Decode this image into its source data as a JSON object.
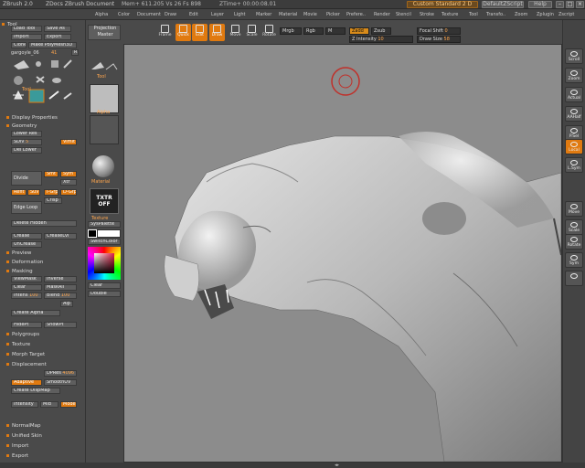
{
  "titlebar": {
    "app": "ZBrush 2.0",
    "doc": "ZDocs ZBrush Document",
    "mem": "Mem+ 611.205 Vs 26 Fs 898",
    "ztime": "ZTime+ 00:00:08.01",
    "script_label": "Custom Standard 2 D",
    "default_script": "DefaultZScript",
    "help": "Help"
  },
  "menu": [
    "Alpha",
    "Color",
    "Document",
    "Draw",
    "Edit",
    "Layer",
    "Light",
    "Marker",
    "Material",
    "Movie",
    "Picker",
    "Prefere..",
    "Render",
    "Stencil",
    "Stroke",
    "Texture",
    "Tool",
    "Transfo..",
    "Zoom",
    "Zplugin",
    "Zscript"
  ],
  "toolbar": {
    "projection_master": "Projection Master",
    "tools": [
      "Frame",
      "Quick",
      "Edit",
      "Draw",
      "Move",
      "Scale",
      "Rotate"
    ],
    "mrgb": "Mrgb",
    "rgb": "Rgb",
    "m": "M",
    "zadd": "Zadd",
    "zsub": "Zsub",
    "z_intensity": "Z Intensity",
    "z_intensity_val": "10",
    "focal_shift": "Focal Shift",
    "focal_shift_val": "0",
    "draw_size": "Draw Size",
    "draw_size_val": "58"
  },
  "left": {
    "tool_header": "Tool",
    "load_tool": "Load Tool",
    "save_as": "Save As",
    "import": "Import",
    "export": "Export",
    "clone": "Clone",
    "make_polymesh": "Make PolyMesh3D",
    "tool_name": "gargoyle_06",
    "tool_num": "41",
    "r": "R",
    "tool_label": "Tool",
    "display_properties": "Display Properties",
    "geometry": "Geometry",
    "lower_res": "Lower Res",
    "sdiv": "SDiv",
    "sdiv_val": "5",
    "vimit": "Vimit",
    "del_lower": "Del Lower",
    "divide": "Divide",
    "smt": "Smt",
    "sym": "Sym",
    "xtr": "Xtr",
    "refit": "Refit",
    "suv": "Suv",
    "igrp": "I-Grp",
    "dgrp": "D-Grp",
    "crisp": "Crisp",
    "edge_loop": "Edge Loop",
    "delete_hidden": "Delete Hidden",
    "crease": "Crease",
    "crease_lvl": "CreaseLvl",
    "uncrease": "UnCrease",
    "preview": "Preview",
    "deformation": "Deformation",
    "masking": "Masking",
    "viewmask": "ViewMask",
    "inverse": "Inverse",
    "clear": "Clear",
    "maskall": "MaskAll",
    "intens": "Intens",
    "intens_val": "100",
    "blend": "Blend",
    "blend_val": "100",
    "alp": "Alp",
    "create_alpha": "Create Alpha",
    "hidept": "HidePt",
    "showpt": "ShowPt",
    "polygroups": "Polygroups",
    "texture": "Texture",
    "morph_target": "Morph Target",
    "displacement": "Displacement",
    "dpres": "DPRes",
    "dpres_val": "4096",
    "adaptive": "Adaptive",
    "smoothuv": "SmoothUV",
    "create_dispmap": "Create DispMap",
    "intensity": "Intensity",
    "intensity_val": "Mid",
    "mode": "Mode",
    "normalmap": "NormalMap",
    "unified_skin": "Unified Skin",
    "import2": "Import",
    "export2": "Export"
  },
  "palette": {
    "tool": "Tool",
    "alpha": "Alpha",
    "material": "Material",
    "txtr_off": "TXTR OFF",
    "texture": "Texture",
    "syspalette": "SysPalette",
    "switchcolor": "SwitchColor",
    "clear": "Clear",
    "double": "Double"
  },
  "right": [
    "Scroll",
    "Zoom",
    "Actual",
    "AAHalf",
    "P.Sel",
    "Local",
    "L.Sym",
    "Move",
    "Scale",
    "Rotate",
    "Sym",
    ""
  ],
  "colors": {
    "accent": "#e07a10",
    "panel": "#4a4a4a",
    "canvas": "#8c8c8c"
  }
}
